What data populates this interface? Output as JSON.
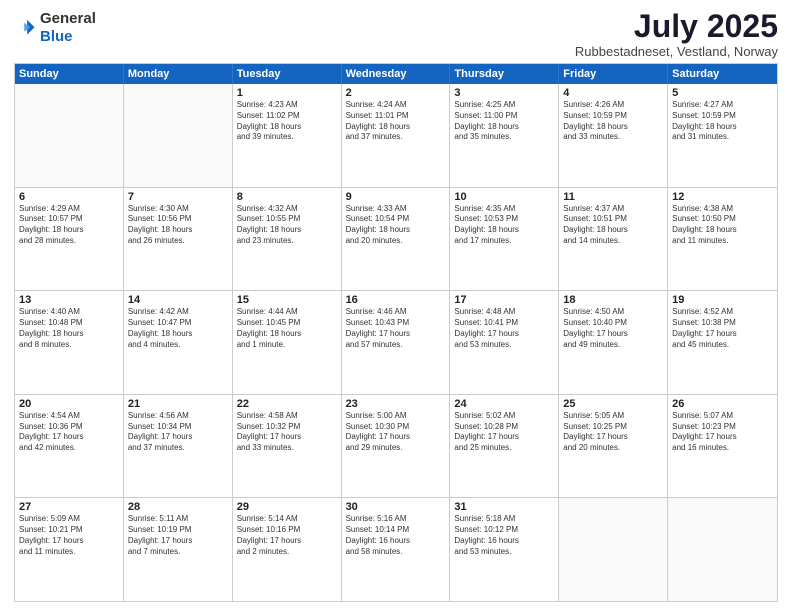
{
  "header": {
    "logo_general": "General",
    "logo_blue": "Blue",
    "month": "July 2025",
    "location": "Rubbestadneset, Vestland, Norway"
  },
  "weekdays": [
    "Sunday",
    "Monday",
    "Tuesday",
    "Wednesday",
    "Thursday",
    "Friday",
    "Saturday"
  ],
  "rows": [
    [
      {
        "day": "",
        "text": ""
      },
      {
        "day": "",
        "text": ""
      },
      {
        "day": "1",
        "text": "Sunrise: 4:23 AM\nSunset: 11:02 PM\nDaylight: 18 hours\nand 39 minutes."
      },
      {
        "day": "2",
        "text": "Sunrise: 4:24 AM\nSunset: 11:01 PM\nDaylight: 18 hours\nand 37 minutes."
      },
      {
        "day": "3",
        "text": "Sunrise: 4:25 AM\nSunset: 11:00 PM\nDaylight: 18 hours\nand 35 minutes."
      },
      {
        "day": "4",
        "text": "Sunrise: 4:26 AM\nSunset: 10:59 PM\nDaylight: 18 hours\nand 33 minutes."
      },
      {
        "day": "5",
        "text": "Sunrise: 4:27 AM\nSunset: 10:59 PM\nDaylight: 18 hours\nand 31 minutes."
      }
    ],
    [
      {
        "day": "6",
        "text": "Sunrise: 4:29 AM\nSunset: 10:57 PM\nDaylight: 18 hours\nand 28 minutes."
      },
      {
        "day": "7",
        "text": "Sunrise: 4:30 AM\nSunset: 10:56 PM\nDaylight: 18 hours\nand 26 minutes."
      },
      {
        "day": "8",
        "text": "Sunrise: 4:32 AM\nSunset: 10:55 PM\nDaylight: 18 hours\nand 23 minutes."
      },
      {
        "day": "9",
        "text": "Sunrise: 4:33 AM\nSunset: 10:54 PM\nDaylight: 18 hours\nand 20 minutes."
      },
      {
        "day": "10",
        "text": "Sunrise: 4:35 AM\nSunset: 10:53 PM\nDaylight: 18 hours\nand 17 minutes."
      },
      {
        "day": "11",
        "text": "Sunrise: 4:37 AM\nSunset: 10:51 PM\nDaylight: 18 hours\nand 14 minutes."
      },
      {
        "day": "12",
        "text": "Sunrise: 4:38 AM\nSunset: 10:50 PM\nDaylight: 18 hours\nand 11 minutes."
      }
    ],
    [
      {
        "day": "13",
        "text": "Sunrise: 4:40 AM\nSunset: 10:48 PM\nDaylight: 18 hours\nand 8 minutes."
      },
      {
        "day": "14",
        "text": "Sunrise: 4:42 AM\nSunset: 10:47 PM\nDaylight: 18 hours\nand 4 minutes."
      },
      {
        "day": "15",
        "text": "Sunrise: 4:44 AM\nSunset: 10:45 PM\nDaylight: 18 hours\nand 1 minute."
      },
      {
        "day": "16",
        "text": "Sunrise: 4:46 AM\nSunset: 10:43 PM\nDaylight: 17 hours\nand 57 minutes."
      },
      {
        "day": "17",
        "text": "Sunrise: 4:48 AM\nSunset: 10:41 PM\nDaylight: 17 hours\nand 53 minutes."
      },
      {
        "day": "18",
        "text": "Sunrise: 4:50 AM\nSunset: 10:40 PM\nDaylight: 17 hours\nand 49 minutes."
      },
      {
        "day": "19",
        "text": "Sunrise: 4:52 AM\nSunset: 10:38 PM\nDaylight: 17 hours\nand 45 minutes."
      }
    ],
    [
      {
        "day": "20",
        "text": "Sunrise: 4:54 AM\nSunset: 10:36 PM\nDaylight: 17 hours\nand 42 minutes."
      },
      {
        "day": "21",
        "text": "Sunrise: 4:56 AM\nSunset: 10:34 PM\nDaylight: 17 hours\nand 37 minutes."
      },
      {
        "day": "22",
        "text": "Sunrise: 4:58 AM\nSunset: 10:32 PM\nDaylight: 17 hours\nand 33 minutes."
      },
      {
        "day": "23",
        "text": "Sunrise: 5:00 AM\nSunset: 10:30 PM\nDaylight: 17 hours\nand 29 minutes."
      },
      {
        "day": "24",
        "text": "Sunrise: 5:02 AM\nSunset: 10:28 PM\nDaylight: 17 hours\nand 25 minutes."
      },
      {
        "day": "25",
        "text": "Sunrise: 5:05 AM\nSunset: 10:25 PM\nDaylight: 17 hours\nand 20 minutes."
      },
      {
        "day": "26",
        "text": "Sunrise: 5:07 AM\nSunset: 10:23 PM\nDaylight: 17 hours\nand 16 minutes."
      }
    ],
    [
      {
        "day": "27",
        "text": "Sunrise: 5:09 AM\nSunset: 10:21 PM\nDaylight: 17 hours\nand 11 minutes."
      },
      {
        "day": "28",
        "text": "Sunrise: 5:11 AM\nSunset: 10:19 PM\nDaylight: 17 hours\nand 7 minutes."
      },
      {
        "day": "29",
        "text": "Sunrise: 5:14 AM\nSunset: 10:16 PM\nDaylight: 17 hours\nand 2 minutes."
      },
      {
        "day": "30",
        "text": "Sunrise: 5:16 AM\nSunset: 10:14 PM\nDaylight: 16 hours\nand 58 minutes."
      },
      {
        "day": "31",
        "text": "Sunrise: 5:18 AM\nSunset: 10:12 PM\nDaylight: 16 hours\nand 53 minutes."
      },
      {
        "day": "",
        "text": ""
      },
      {
        "day": "",
        "text": ""
      }
    ]
  ]
}
